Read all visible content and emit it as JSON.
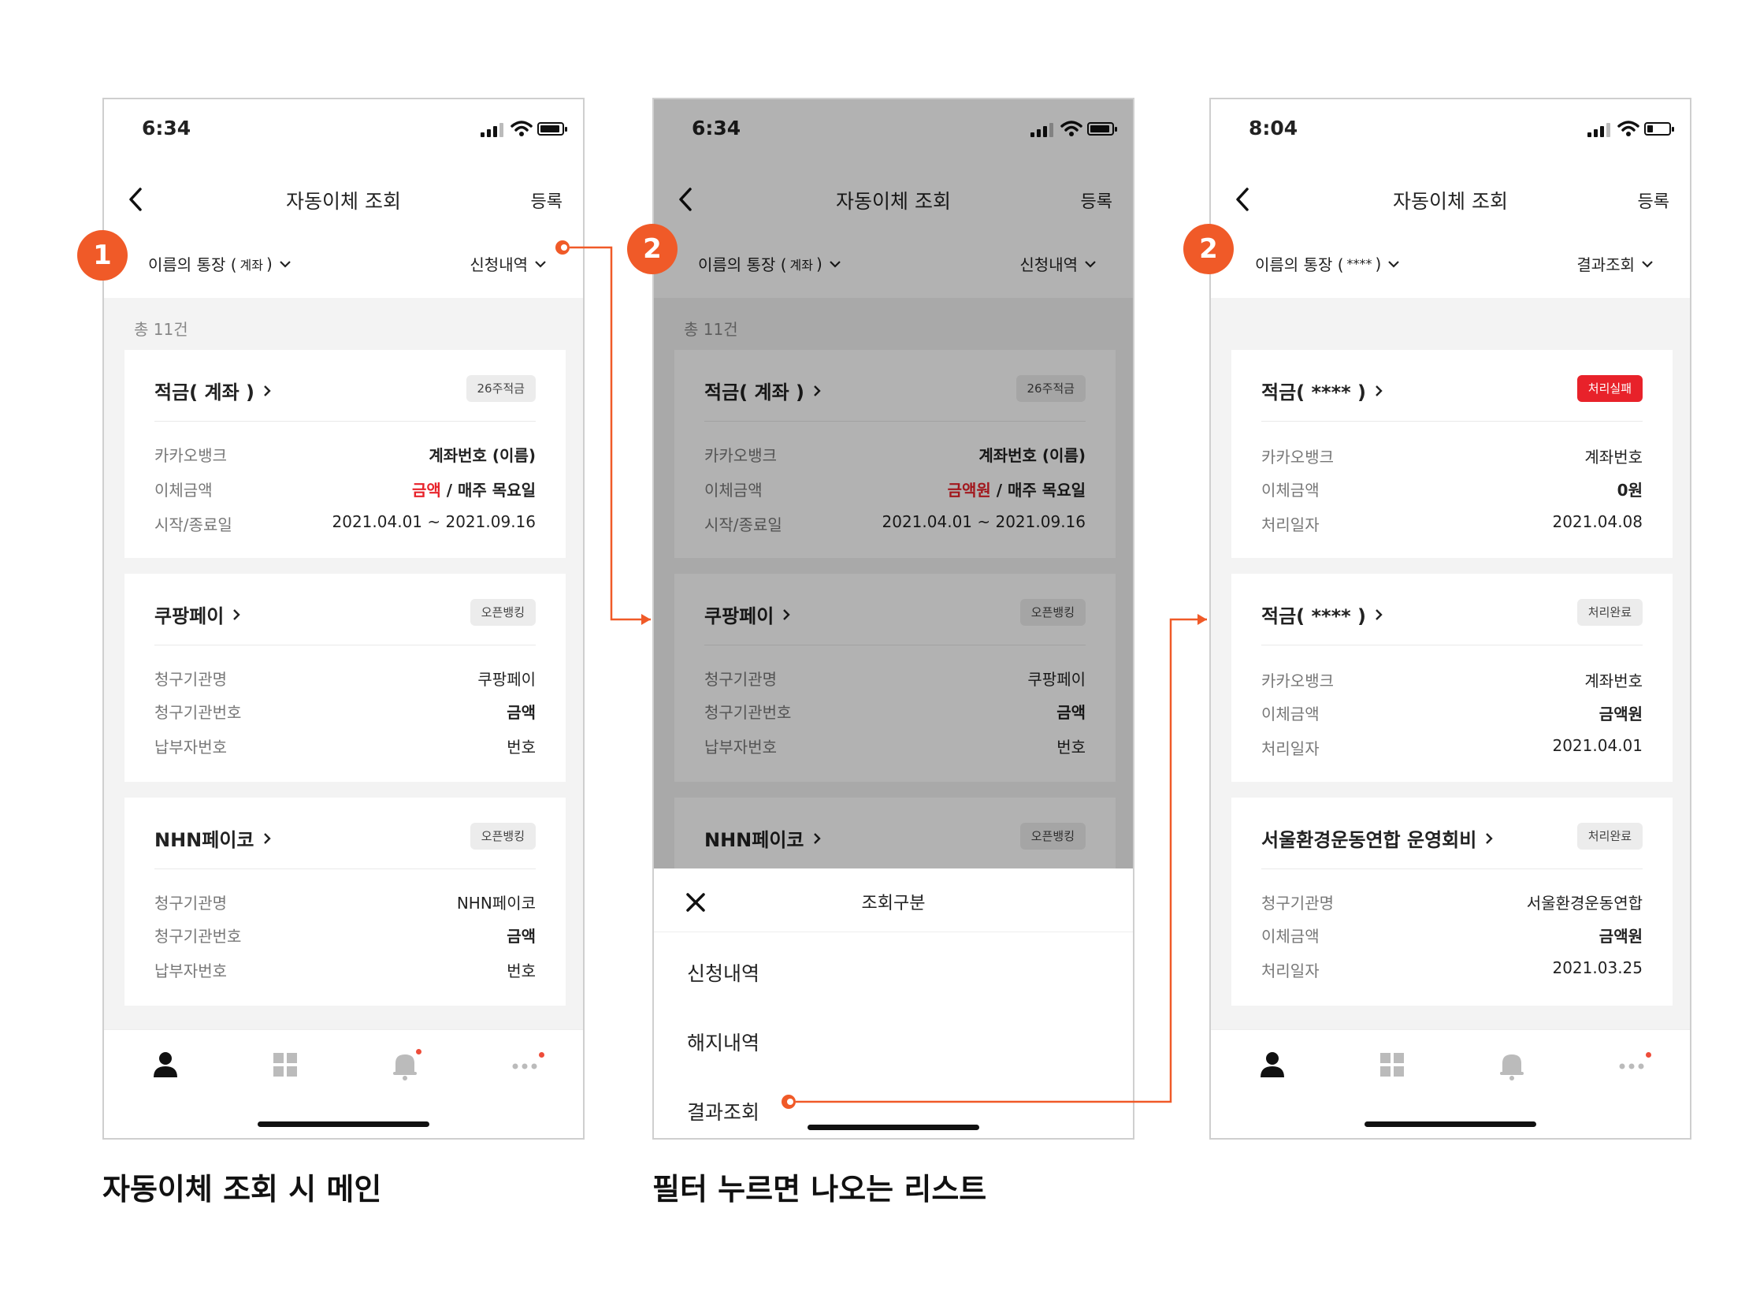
{
  "colors": {
    "accent": "#f05a28",
    "danger": "#e8222a",
    "badge_bg": "#ececec"
  },
  "screens": [
    {
      "time": "6:34",
      "nav": {
        "title": "자동이체 조회",
        "action": "등록"
      },
      "filter": {
        "account_prefix": "이름의 통장 (",
        "account_masked": "계좌",
        "account_suffix": ")",
        "kind": "신청내역"
      },
      "total": "총 11건",
      "cards": [
        {
          "title": "적금( 계좌 )",
          "badge": "26주적금",
          "rows": [
            {
              "label": "카카오뱅크",
              "value": "계좌번호 (이름)"
            },
            {
              "label": "이체금액",
              "value_red": "금액",
              "value_rest": " / 매주 목요일"
            },
            {
              "label": "시작/종료일",
              "value": "2021.04.01 ~ 2021.09.16"
            }
          ]
        },
        {
          "title": "쿠팡페이",
          "badge": "오픈뱅킹",
          "rows": [
            {
              "label": "청구기관명",
              "value": "쿠팡페이"
            },
            {
              "label": "청구기관번호",
              "value_red": "금액"
            },
            {
              "label": "납부자번호",
              "value": "번호"
            }
          ]
        },
        {
          "title": "NHN페이코",
          "badge": "오픈뱅킹",
          "rows": [
            {
              "label": "청구기관명",
              "value": "NHN페이코"
            },
            {
              "label": "청구기관번호",
              "value_red": "금액"
            },
            {
              "label": "납부자번호",
              "value": "번호"
            }
          ]
        }
      ]
    },
    {
      "time": "6:34",
      "nav": {
        "title": "자동이체 조회",
        "action": "등록"
      },
      "filter": {
        "account_prefix": "이름의 통장 (",
        "account_masked": "계좌",
        "account_suffix": ")",
        "kind": "신청내역"
      },
      "total": "총 11건",
      "cards": [
        {
          "title": "적금( 계좌 )",
          "badge": "26주적금",
          "rows": [
            {
              "label": "카카오뱅크",
              "value": "계좌번호 (이름)"
            },
            {
              "label": "이체금액",
              "value_red": "금액원",
              "value_rest": " / 매주 목요일"
            },
            {
              "label": "시작/종료일",
              "value": "2021.04.01 ~ 2021.09.16"
            }
          ]
        },
        {
          "title": "쿠팡페이",
          "badge": "오픈뱅킹",
          "rows": [
            {
              "label": "청구기관명",
              "value": "쿠팡페이"
            },
            {
              "label": "청구기관번호",
              "value_red": "금액"
            },
            {
              "label": "납부자번호",
              "value": "번호"
            }
          ]
        },
        {
          "title": "NHN페이코",
          "badge": "오픈뱅킹",
          "rows": []
        }
      ],
      "sheet": {
        "title": "조회구분",
        "items": [
          "신청내역",
          "해지내역",
          "결과조회"
        ]
      }
    },
    {
      "time": "8:04",
      "nav": {
        "title": "자동이체 조회",
        "action": "등록"
      },
      "filter": {
        "account_prefix": "이름의 통장 (",
        "account_masked": "****",
        "account_suffix": ")",
        "kind": "결과조회"
      },
      "cards": [
        {
          "title": "적금( **** )",
          "badge": "처리실패",
          "rows": [
            {
              "label": "카카오뱅크",
              "value": "계좌번호"
            },
            {
              "label": "이체금액",
              "value_red": "0원"
            },
            {
              "label": "처리일자",
              "value": "2021.04.08"
            }
          ]
        },
        {
          "title": "적금( **** )",
          "badge": "처리완료",
          "rows": [
            {
              "label": "카카오뱅크",
              "value": "계좌번호"
            },
            {
              "label": "이체금액",
              "value_red": "금액원"
            },
            {
              "label": "처리일자",
              "value": "2021.04.01"
            }
          ]
        },
        {
          "title": "서울환경운동연합 운영회비",
          "badge": "처리완료",
          "rows": [
            {
              "label": "청구기관명",
              "value": "서울환경운동연합"
            },
            {
              "label": "이체금액",
              "value_red": "금액원"
            },
            {
              "label": "처리일자",
              "value": "2021.03.25"
            }
          ]
        }
      ]
    }
  ],
  "steps": [
    "1",
    "2",
    "2"
  ],
  "captions": [
    "자동이체 조회 시 메인",
    "필터 누르면 나오는 리스트"
  ]
}
